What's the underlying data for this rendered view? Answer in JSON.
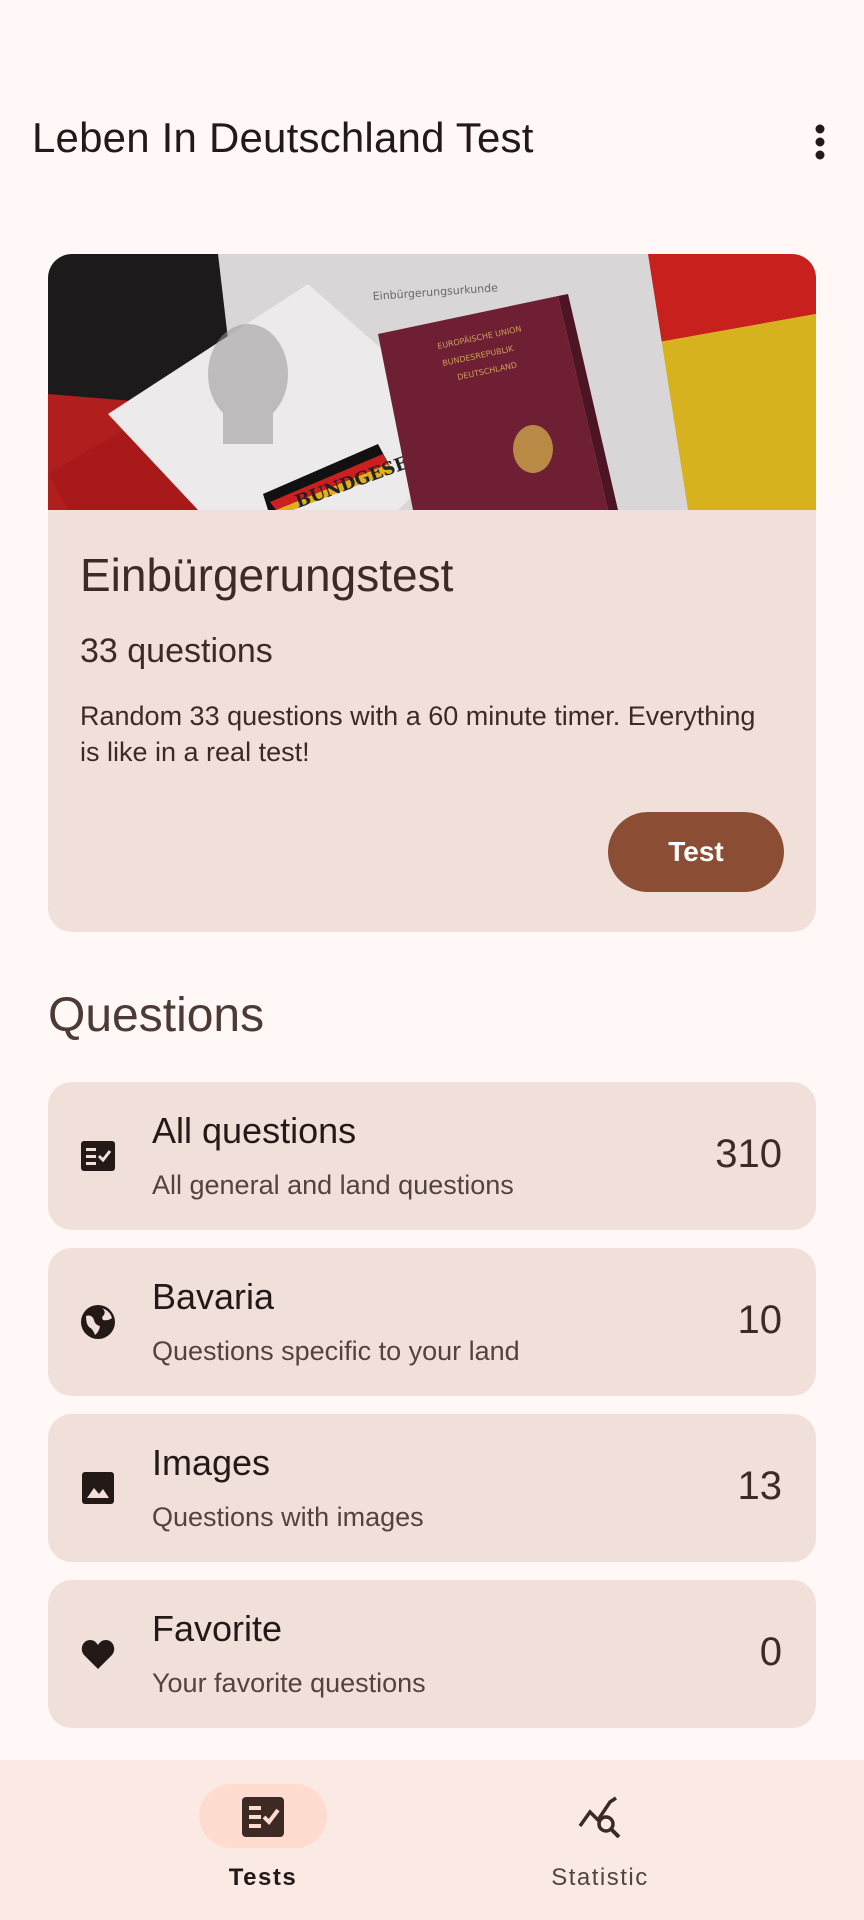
{
  "app_bar": {
    "title": "Leben In Deutschland Test",
    "more_icon": "more-vert-icon"
  },
  "hero": {
    "image": "passport-and-naturalization-certificate-on-german-flag",
    "image_text": {
      "certificate": "Einbürgerungsurkunde",
      "book": "BUNDGESETZ",
      "passport_line1": "EUROPÄISCHE UNION",
      "passport_line2": "BUNDESREPUBLIK",
      "passport_line3": "DEUTSCHLAND"
    },
    "title": "Einbürgerungstest",
    "subtitle": "33 questions",
    "description": "Random 33 questions with a 60 minute timer. Everything is like in a real test!",
    "button_label": "Test"
  },
  "questions": {
    "section_title": "Questions",
    "items": [
      {
        "icon": "checklist-icon",
        "title": "All questions",
        "subtitle": "All general and land questions",
        "count": "310"
      },
      {
        "icon": "globe-icon",
        "title": "Bavaria",
        "subtitle": "Questions specific to your land",
        "count": "10"
      },
      {
        "icon": "image-icon",
        "title": "Images",
        "subtitle": "Questions with images",
        "count": "13"
      },
      {
        "icon": "heart-icon",
        "title": "Favorite",
        "subtitle": "Your favorite questions",
        "count": "0"
      }
    ]
  },
  "bottom_nav": {
    "items": [
      {
        "label": "Tests",
        "icon": "checklist-icon",
        "active": true
      },
      {
        "label": "Statistic",
        "icon": "query-stats-icon",
        "active": false
      }
    ]
  },
  "colors": {
    "background": "#fff8f6",
    "card": "#f1dfda",
    "primary_button": "#8b4d33",
    "nav_background": "#fbe9e4",
    "nav_active_pill": "#ffdbd0"
  }
}
